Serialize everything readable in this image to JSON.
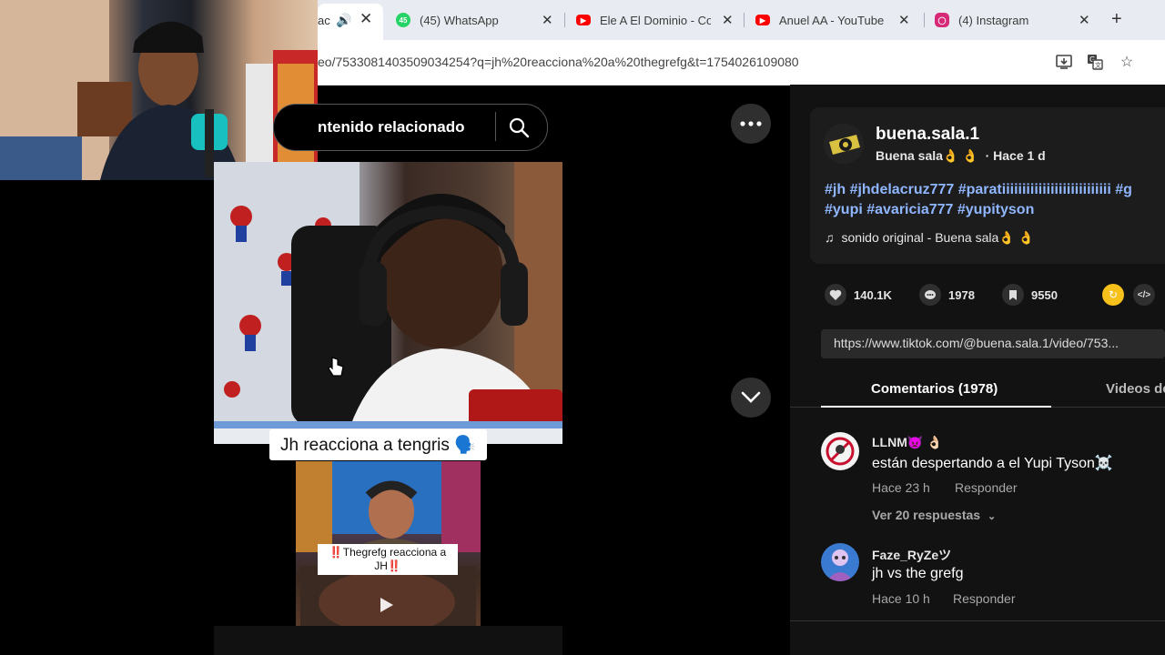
{
  "browser": {
    "tabs": [
      {
        "label": "ac",
        "favicon": "speaker-icon"
      },
      {
        "label": "(45) WhatsApp",
        "favicon": "whatsapp-icon",
        "badge": "45"
      },
      {
        "label": "Ele A El Dominio - Co",
        "favicon": "youtube-icon"
      },
      {
        "label": "Anuel AA - YouTube",
        "favicon": "youtube-icon"
      },
      {
        "label": "(4) Instagram",
        "favicon": "instagram-icon"
      }
    ],
    "url": "eo/7533081403509034254?q=jh%20reacciona%20a%20thegrefg&t=1754026109080",
    "colors": {
      "whatsapp": "#25d366",
      "youtube": "#ff0000",
      "instagram": "#d62976"
    }
  },
  "search": {
    "text": "ntenido relacionado"
  },
  "video": {
    "caption": "Jh reacciona a tengris 🗣️",
    "related_caption_1": "‼️Thegrefg reacciona a",
    "related_caption_2": "JH‼️"
  },
  "post": {
    "username": "buena.sala.1",
    "display_name": "Buena sala👌 👌",
    "time": "· Hace 1 d",
    "hashtags_line1": "#jh #jhdelacruz777 #paratiiiiiiiiiiiiiiiiiiiiiiiiiii #g",
    "hashtags_line2": "#yupi #avaricia777 #yupityson",
    "sound": "sonido original - Buena sala👌 👌",
    "likes": "140.1K",
    "comments": "1978",
    "saves": "9550",
    "link": "https://www.tiktok.com/@buena.sala.1/video/753..."
  },
  "tabs": {
    "comments": "Comentarios (1978)",
    "videos": "Videos de"
  },
  "comments": [
    {
      "name": "LLNM👿 👌🏻",
      "text": "están despertando a el Yupi Tyson☠️",
      "time": "Hace 23 h",
      "reply": "Responder",
      "view_replies": "Ver 20 respuestas"
    },
    {
      "name": "Faze_RyZeツ",
      "text": "jh vs the grefg",
      "time": "Hace 10 h",
      "reply": "Responder"
    }
  ]
}
